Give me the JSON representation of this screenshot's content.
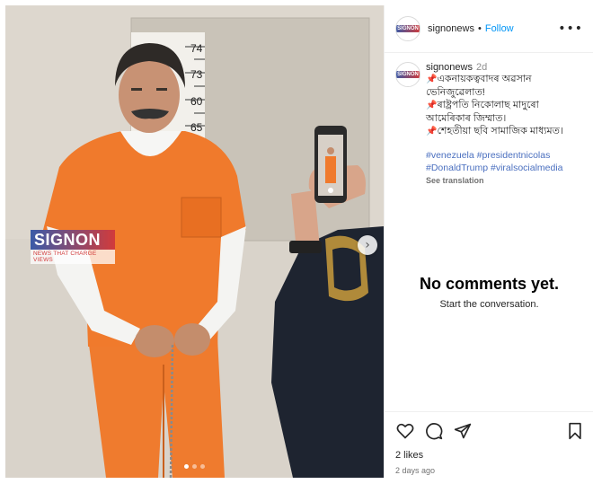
{
  "post": {
    "watermark": {
      "brand": "SIGNON",
      "tagline": "NEWS THAT CHARGE VIEWS"
    },
    "height_chart_marks": [
      "74",
      "73",
      "60",
      "65"
    ],
    "carousel": {
      "total": 3,
      "active": 1
    }
  },
  "header": {
    "username": "signonews",
    "separator": "•",
    "follow_label": "Follow",
    "more_label": "•••"
  },
  "caption": {
    "username": "signonews",
    "time": "2d",
    "lines": [
      "একনায়কত্ববাদৰ অৱসান ভেনিজুৱেলাত!",
      "ৰাষ্ট্ৰপতি নিকোলাছ মাদুৰো আমেৰিকাৰ জিম্মাত।",
      "শেহতীয়া ছবি সামাজিক মাধ্যমত।"
    ],
    "hashtags": [
      "#venezuela",
      "#presidentnicolas",
      "#DonaldTrump",
      "#viralsocialmedia"
    ],
    "see_translation": "See translation"
  },
  "comments": {
    "empty_title": "No comments yet.",
    "empty_subtitle": "Start the conversation."
  },
  "footer": {
    "likes": "2 likes",
    "date": "2 days ago"
  },
  "colors": {
    "follow": "#0095f6",
    "hashtag": "#4a6fbf",
    "orange_jumpsuit": "#f07a2c",
    "uniform": "#1e2430"
  },
  "icons": [
    "heart-icon",
    "comment-icon",
    "share-icon",
    "bookmark-icon",
    "more-icon",
    "chevron-right-icon"
  ]
}
